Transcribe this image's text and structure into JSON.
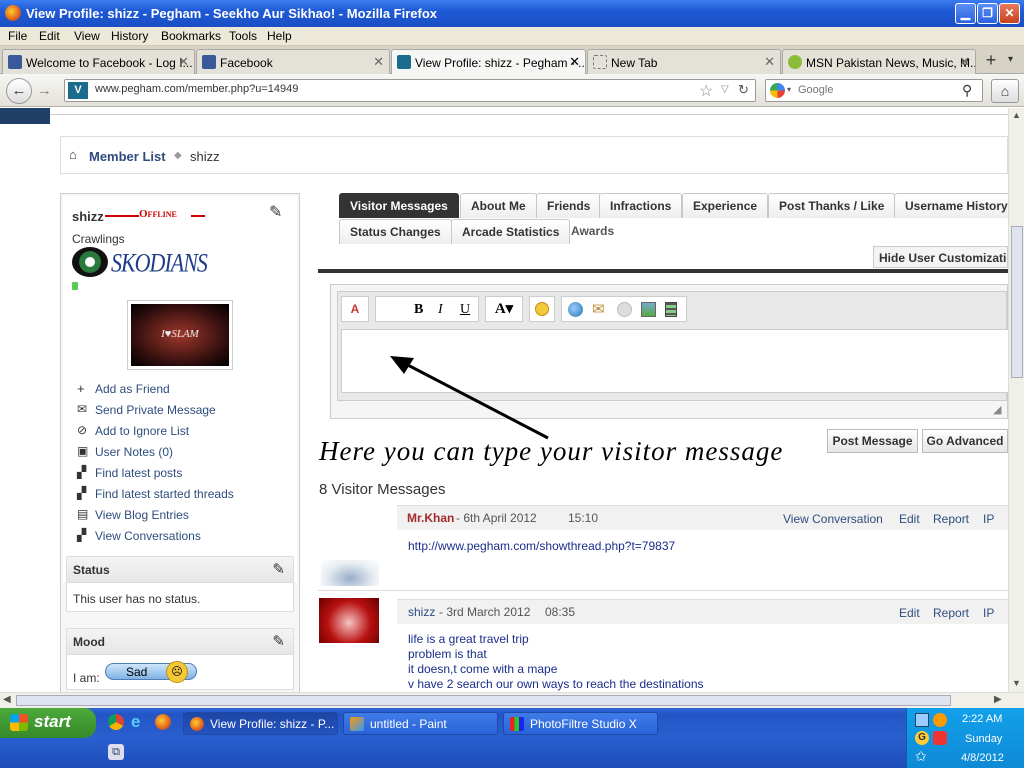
{
  "window": {
    "title": "View Profile: shizz - Pegham - Seekho Aur Sikhao! - Mozilla Firefox"
  },
  "menu": [
    "File",
    "Edit",
    "View",
    "History",
    "Bookmarks",
    "Tools",
    "Help"
  ],
  "tabs": [
    {
      "label": "Welcome to Facebook - Log I..."
    },
    {
      "label": "Facebook"
    },
    {
      "label": "View Profile: shizz - Pegham - ..."
    },
    {
      "label": "New Tab"
    },
    {
      "label": "MSN Pakistan News, Music, M..."
    }
  ],
  "nav": {
    "url": "www.pegham.com/member.php?u=14949",
    "search_placeholder": "Google"
  },
  "breadcrumb": {
    "root": "Member List",
    "current": "shizz"
  },
  "profile": {
    "username": "shizz",
    "status_word": "Offline",
    "rank": "Crawlings",
    "group_logo_text": "SKODIANS",
    "avatar_text": "I♥SLAM",
    "actions": [
      "Add as Friend",
      "Send Private Message",
      "Add to Ignore List",
      "User Notes (0)",
      "Find latest posts",
      "Find latest started threads",
      "View Blog Entries",
      "View Conversations"
    ],
    "status_heading": "Status",
    "status_text": "This user has no status.",
    "mood_heading": "Mood",
    "mood_label": "I am:",
    "mood_value": "Sad"
  },
  "profile_tabs": [
    "Visitor Messages",
    "About Me",
    "Friends",
    "Infractions",
    "Experience",
    "Post Thanks / Like",
    "Username History"
  ],
  "profile_tabs_row2": [
    "Status Changes",
    "Arcade Statistics"
  ],
  "awards_label": "Awards",
  "hide_customization": "Hide User Customizatio",
  "editor": {
    "post_button": "Post Message",
    "advanced_button": "Go Advanced"
  },
  "annotation": "Here you can type your visitor message",
  "messages_heading": "8 Visitor Messages",
  "messages": [
    {
      "author": "Mr.Khan",
      "date": "- 6th April 2012",
      "time": "15:10",
      "actions": [
        "View Conversation",
        "Edit",
        "Report",
        "IP"
      ],
      "lines": [
        "http://www.pegham.com/showthread.php?t=79837"
      ]
    },
    {
      "author": "shizz",
      "date": "- 3rd March 2012",
      "time": "08:35",
      "actions": [
        "Edit",
        "Report",
        "IP"
      ],
      "lines": [
        "life is a great travel trip",
        "problem is that",
        "it doesn,t come with a mape",
        "v have 2 search our own ways to reach the destinations"
      ]
    }
  ],
  "taskbar": {
    "start": "start",
    "tasks": [
      "View Profile: shizz - P...",
      "untitled - Paint",
      "PhotoFiltre Studio X"
    ],
    "clock_time": "2:22 AM",
    "clock_day": "Sunday",
    "clock_date": "4/8/2012"
  },
  "colors": {
    "accent": "#2e4d7e",
    "author_red": "#a52a2a",
    "offline_red": "#cc0000",
    "taskbar_blue": "#245edb"
  }
}
